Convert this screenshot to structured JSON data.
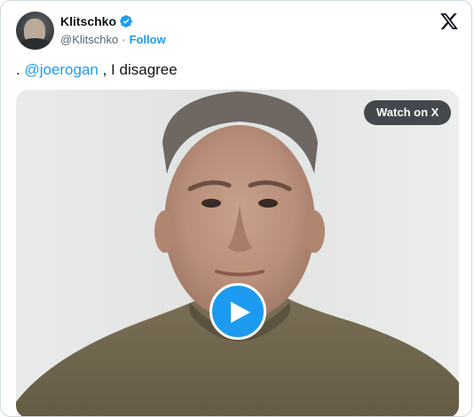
{
  "author": {
    "name": "Klitschko",
    "handle": "@Klitschko",
    "separator": "·",
    "follow_label": "Follow",
    "verified": true
  },
  "tweet": {
    "prefix": ". ",
    "mention": "@joerogan",
    "suffix": " , I disagree"
  },
  "media": {
    "watch_label": "Watch on X",
    "type": "video"
  },
  "colors": {
    "accent": "#1d9bf0",
    "text": "#0f1419",
    "secondary": "#536471"
  },
  "icons": {
    "brand": "x-logo-icon",
    "verified": "verified-badge-icon",
    "play": "play-icon"
  }
}
